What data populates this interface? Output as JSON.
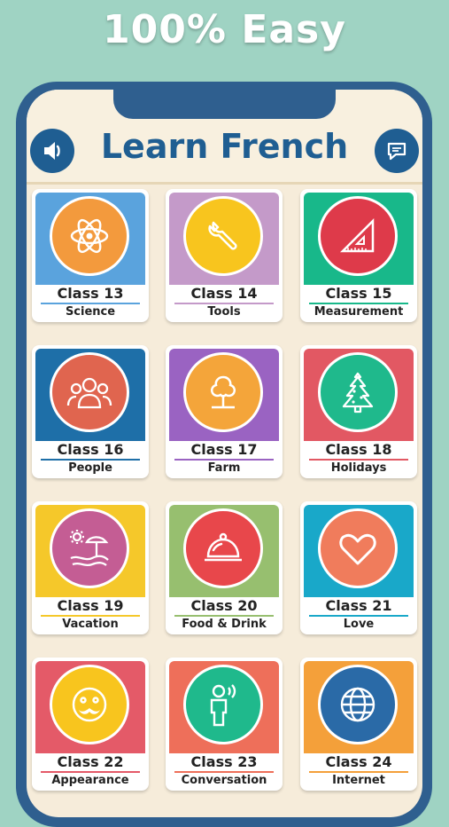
{
  "promo": {
    "headline": "100% Easy"
  },
  "app": {
    "title": "Learn French"
  },
  "icons": {
    "sound": "speaker-icon",
    "chat": "chat-bubble-icon"
  },
  "classes": [
    {
      "label": "Class 13",
      "topic": "Science",
      "bg": "#5aa3dd",
      "circle": "#f39a3d",
      "bar": "#5aa3dd",
      "icon": "atom-icon"
    },
    {
      "label": "Class 14",
      "topic": "Tools",
      "bg": "#c49ac9",
      "circle": "#f8c51e",
      "bar": "#c49ac9",
      "icon": "wrench-icon"
    },
    {
      "label": "Class 15",
      "topic": "Measurement",
      "bg": "#18b88a",
      "circle": "#de3a4a",
      "bar": "#18b88a",
      "icon": "set-square-icon"
    },
    {
      "label": "Class 16",
      "topic": "People",
      "bg": "#1e6fa8",
      "circle": "#e0654f",
      "bar": "#1e6fa8",
      "icon": "people-icon"
    },
    {
      "label": "Class 17",
      "topic": "Farm",
      "bg": "#9a63c2",
      "circle": "#f4a53a",
      "bar": "#9a63c2",
      "icon": "tree-icon"
    },
    {
      "label": "Class 18",
      "topic": "Holidays",
      "bg": "#e25863",
      "circle": "#1fb98c",
      "bar": "#e25863",
      "icon": "christmas-tree-icon"
    },
    {
      "label": "Class 19",
      "topic": "Vacation",
      "bg": "#f5c82a",
      "circle": "#c45d94",
      "bar": "#f5c82a",
      "icon": "beach-umbrella-icon"
    },
    {
      "label": "Class 20",
      "topic": "Food & Drink",
      "bg": "#97bf6f",
      "circle": "#e8474b",
      "bar": "#97bf6f",
      "icon": "cloche-icon"
    },
    {
      "label": "Class 21",
      "topic": "Love",
      "bg": "#19a8c9",
      "circle": "#f07c5c",
      "bar": "#19a8c9",
      "icon": "heart-icon"
    },
    {
      "label": "Class 22",
      "topic": "Appearance",
      "bg": "#e45a68",
      "circle": "#f8c51e",
      "bar": "#e45a68",
      "icon": "mustache-face-icon"
    },
    {
      "label": "Class 23",
      "topic": "Conversation",
      "bg": "#ee6f5a",
      "circle": "#1fb98c",
      "bar": "#ee6f5a",
      "icon": "speaking-person-icon"
    },
    {
      "label": "Class 24",
      "topic": "Internet",
      "bg": "#f4a03a",
      "circle": "#2a6aa7",
      "bar": "#f4a03a",
      "icon": "globe-icon"
    }
  ]
}
